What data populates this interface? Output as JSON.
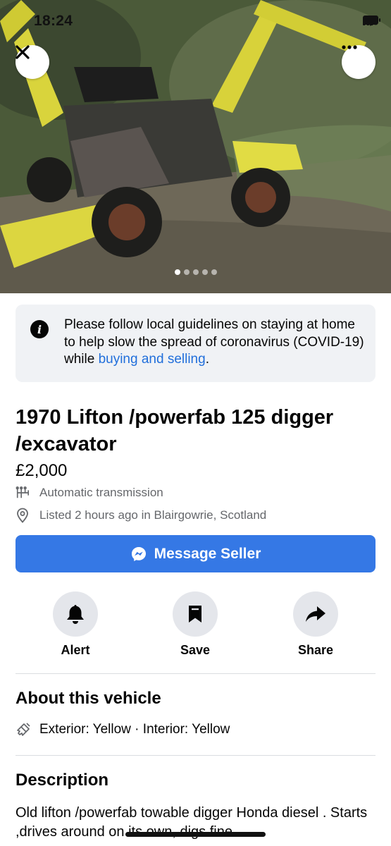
{
  "status_bar": {
    "time": "18:24"
  },
  "gallery": {
    "image_count": 5,
    "active_index": 0,
    "image_alt": "Yellow 1970 Lifton powerfab digger excavator"
  },
  "notice": {
    "text": "Please follow local guidelines on staying at home to help slow the spread of coronavirus (COVID-19) while ",
    "link_text": "buying and selling",
    "suffix": "."
  },
  "listing": {
    "title": "1970 Lifton /powerfab 125 digger /excavator",
    "price": "£2,000",
    "transmission": "Automatic transmission",
    "listed": "Listed 2 hours ago in Blairgowrie, Scotland"
  },
  "message_button": {
    "label": "Message Seller"
  },
  "actions": [
    {
      "label": "Alert",
      "icon": "bell-icon"
    },
    {
      "label": "Save",
      "icon": "bookmark-icon"
    },
    {
      "label": "Share",
      "icon": "share-arrow-icon"
    }
  ],
  "about": {
    "heading": "About this vehicle",
    "colors": "Exterior: Yellow · Interior: Yellow"
  },
  "description": {
    "heading": "Description",
    "text": "Old lifton  /powerfab towable digger  Honda diesel  . Starts ,drives around on its own, digs fine"
  },
  "colors": {
    "accent": "#3578e5",
    "link": "#216fdb",
    "notice_bg": "#f0f2f5",
    "action_bg": "#e4e6eb",
    "muted": "#65676b"
  }
}
